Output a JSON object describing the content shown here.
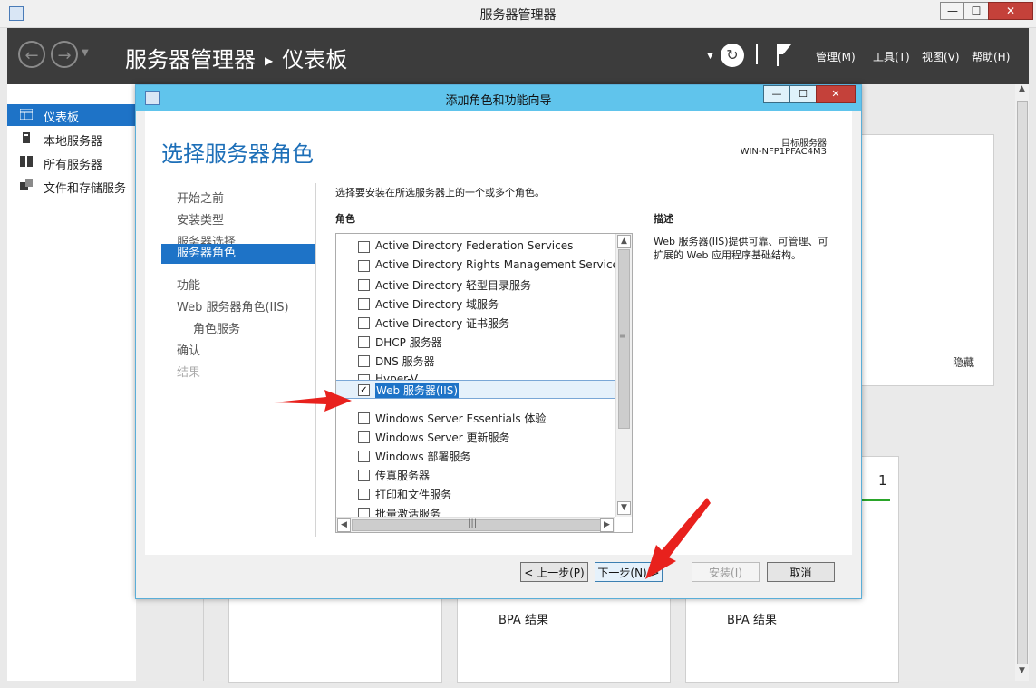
{
  "window": {
    "title": "服务器管理器",
    "controls": {
      "minimize": "—",
      "maximize": "☐",
      "close": "✕"
    }
  },
  "header": {
    "breadcrumb_root": "服务器管理器",
    "breadcrumb_current": "仪表板",
    "menu": [
      "管理(M)",
      "工具(T)",
      "视图(V)",
      "帮助(H)"
    ]
  },
  "sidebar": {
    "items": [
      {
        "label": "仪表板",
        "icon": "dashboard-icon",
        "selected": true
      },
      {
        "label": "本地服务器",
        "icon": "server-icon",
        "selected": false
      },
      {
        "label": "所有服务器",
        "icon": "servers-icon",
        "selected": false
      },
      {
        "label": "文件和存储服务",
        "icon": "storage-icon",
        "selected": false
      }
    ]
  },
  "background": {
    "hide_link": "隐藏",
    "count": "1",
    "bpa1": "BPA 结果",
    "bpa2": "BPA 结果"
  },
  "dialog": {
    "title": "添加角色和功能向导",
    "heading": "选择服务器角色",
    "target_label": "目标服务器",
    "target_server": "WIN-NFP1PFAC4M3",
    "steps": [
      {
        "label": "开始之前",
        "state": "normal"
      },
      {
        "label": "安装类型",
        "state": "normal"
      },
      {
        "label": "服务器选择",
        "state": "normal"
      },
      {
        "label": "服务器角色",
        "state": "current"
      },
      {
        "label": "功能",
        "state": "normal"
      },
      {
        "label": "Web 服务器角色(IIS)",
        "state": "normal"
      },
      {
        "label": "角色服务",
        "state": "sub"
      },
      {
        "label": "确认",
        "state": "normal"
      },
      {
        "label": "结果",
        "state": "disabled"
      }
    ],
    "instruction": "选择要安装在所选服务器上的一个或多个角色。",
    "roles_label": "角色",
    "description_label": "描述",
    "description": "Web 服务器(IIS)提供可靠、可管理、可扩展的 Web 应用程序基础结构。",
    "roles": [
      {
        "label": "Active Directory Federation Services",
        "checked": false
      },
      {
        "label": "Active Directory Rights Management Services",
        "checked": false
      },
      {
        "label": "Active Directory 轻型目录服务",
        "checked": false
      },
      {
        "label": "Active Directory 域服务",
        "checked": false
      },
      {
        "label": "Active Directory 证书服务",
        "checked": false
      },
      {
        "label": "DHCP 服务器",
        "checked": false
      },
      {
        "label": "DNS 服务器",
        "checked": false
      },
      {
        "label": "Hyper-V",
        "checked": false
      },
      {
        "label": "Web 服务器(IIS)",
        "checked": true,
        "selected": true
      },
      {
        "label": "Windows Server Essentials 体验",
        "checked": false
      },
      {
        "label": "Windows Server 更新服务",
        "checked": false
      },
      {
        "label": "Windows 部署服务",
        "checked": false
      },
      {
        "label": "传真服务器",
        "checked": false
      },
      {
        "label": "打印和文件服务",
        "checked": false
      },
      {
        "label": "批量激活服务",
        "checked": false
      }
    ],
    "buttons": {
      "prev": "< 上一步(P)",
      "next": "下一步(N) >",
      "install": "安装(I)",
      "cancel": "取消"
    }
  },
  "colors": {
    "accent": "#1e73c7",
    "dialog_titlebar": "#60c4ec",
    "header_bg": "#3c3c3c",
    "arrow": "#e8211d"
  }
}
